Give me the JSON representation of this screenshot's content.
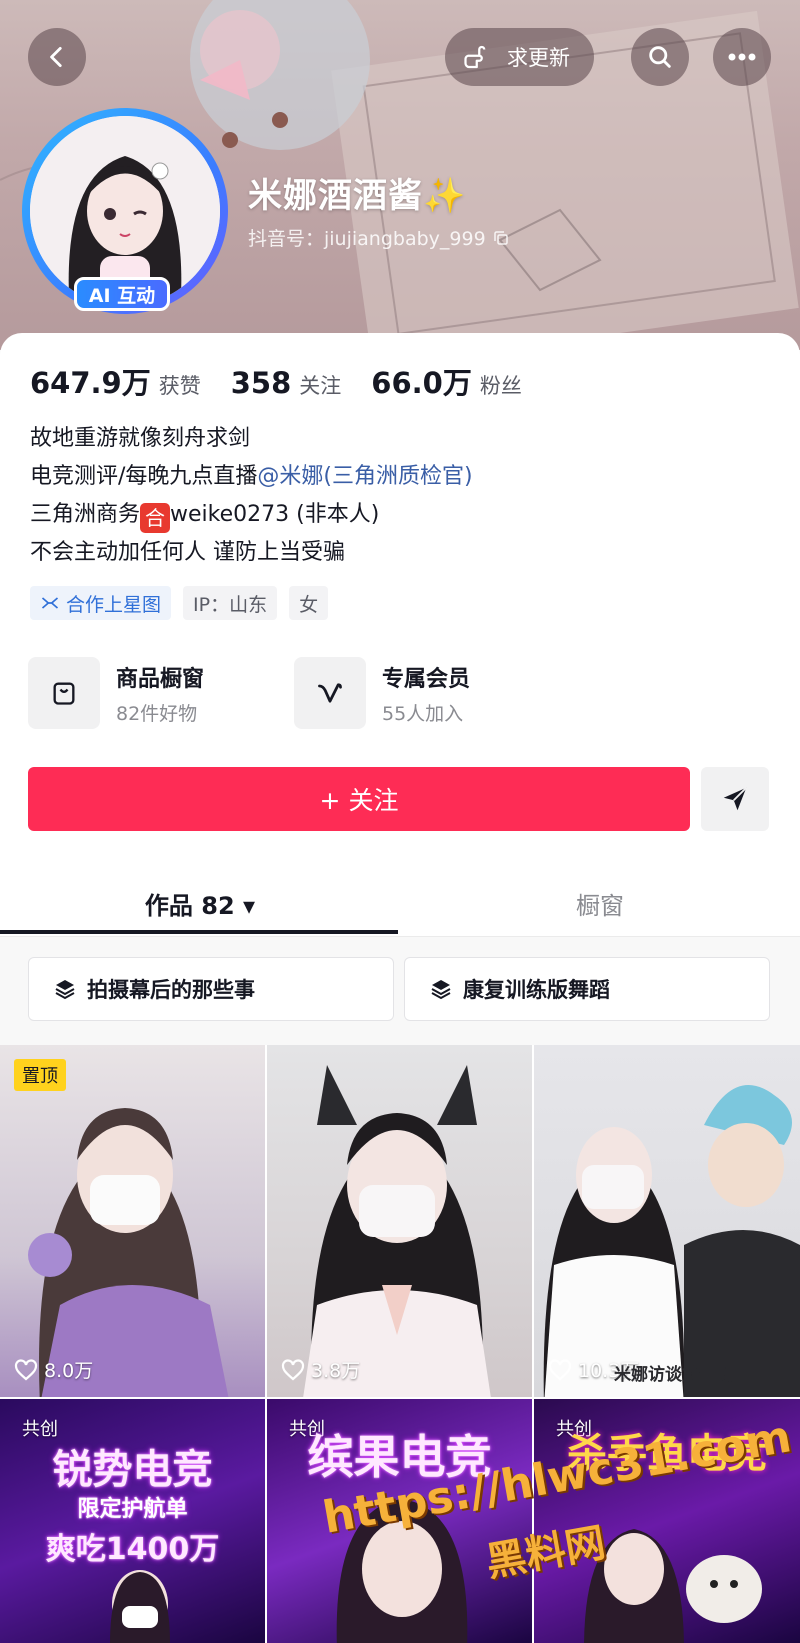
{
  "header": {
    "request_update_label": "求更新"
  },
  "profile": {
    "name": "米娜酒酒酱✨",
    "douyin_id": "抖音号：jiujiangbaby_999",
    "ai_badge": "AI 互动"
  },
  "stats": {
    "likes_value": "647.9万",
    "likes_label": "获赞",
    "following_value": "358",
    "following_label": "关注",
    "fans_value": "66.0万",
    "fans_label": "粉丝"
  },
  "bio": {
    "line1": "故地重游就像刻舟求剑",
    "line2_prefix": "电竞测评/每晚九点直播",
    "line2_mention": "@米娜(三角洲质检官)",
    "line3_prefix": "三角洲商务",
    "line3_badge": "合",
    "line3_suffix": "weike0273 (非本人)",
    "line4": "不会主动加任何人 谨防上当受骗"
  },
  "tags": {
    "star_map": "合作上星图",
    "ip": "IP：山东",
    "gender": "女"
  },
  "cards": {
    "shop_title": "商品橱窗",
    "shop_sub": "82件好物",
    "member_title": "专属会员",
    "member_sub": "55人加入"
  },
  "actions": {
    "follow_label": "+ 关注"
  },
  "tabs": {
    "works_label": "作品 82 ▾",
    "shop_label": "橱窗"
  },
  "collections": [
    "拍摄幕后的那些事",
    "康复训练版舞蹈"
  ],
  "videos": [
    {
      "likes": "8.0万",
      "badge": "置顶"
    },
    {
      "likes": "3.8万"
    },
    {
      "likes": "10.3万",
      "caption": "米娜访谈第一期"
    },
    {
      "badge": "共创",
      "title": "锐势电竞",
      "subtitle": "限定护航单",
      "subtitle2": "爽吃1400万"
    },
    {
      "badge": "共创",
      "title": "缤果电竞"
    },
    {
      "badge": "共创",
      "title": "杀手鱼电竞"
    }
  ],
  "watermark": {
    "url": "https://hlwc31.com",
    "site": "黑料网"
  },
  "colors": {
    "follow_red": "#fe2c55",
    "mention_blue": "#3a5ea6",
    "pinned_yellow": "#ffd21d"
  }
}
